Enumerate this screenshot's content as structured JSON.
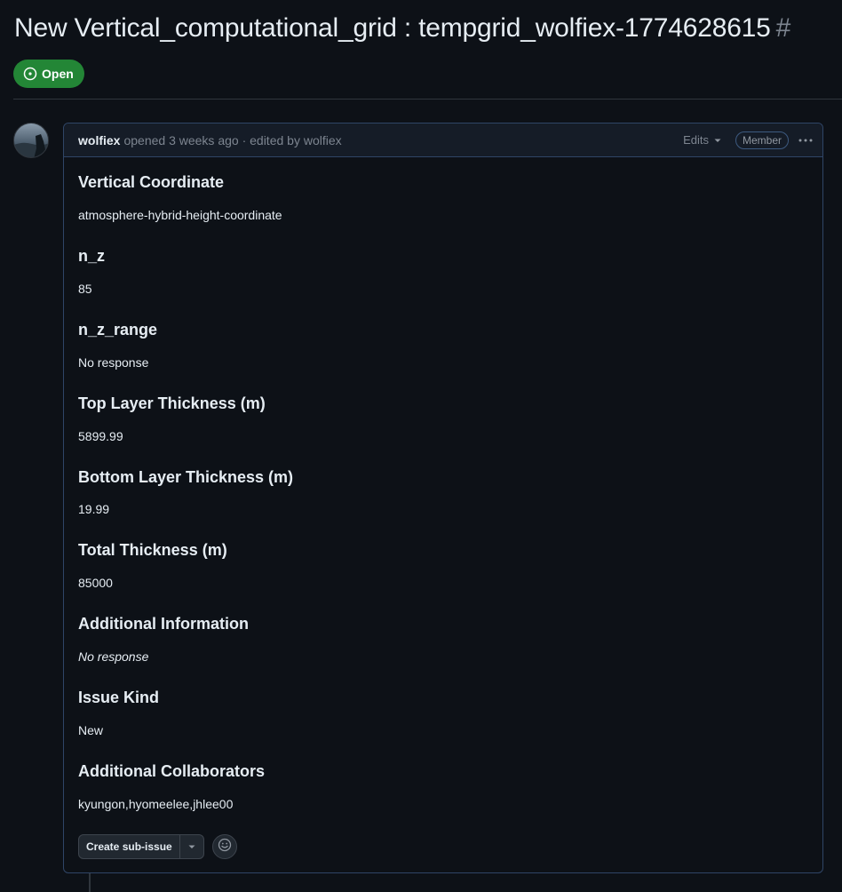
{
  "issue": {
    "title": "New Vertical_computational_grid : tempgrid_wolfiex-1774628615",
    "number_prefix": "#",
    "state": "Open",
    "state_color": "#238636"
  },
  "comment": {
    "author": "wolfiex",
    "meta": "opened 3 weeks ago · edited by wolfiex",
    "edits_label": "Edits",
    "role_badge": "Member",
    "more_icon": "kebab-horizontal-icon"
  },
  "fields": [
    {
      "heading": "Vertical Coordinate",
      "value": "atmosphere-hybrid-height-coordinate"
    },
    {
      "heading": "n_z",
      "value": "85"
    },
    {
      "heading": "n_z_range",
      "value": "No response"
    },
    {
      "heading": "Top Layer Thickness (m)",
      "value": "5899.99"
    },
    {
      "heading": "Bottom Layer Thickness (m)",
      "value": "19.99"
    },
    {
      "heading": "Total Thickness (m)",
      "value": "85000"
    },
    {
      "heading": "Additional Information",
      "value": "No response"
    },
    {
      "heading": "Issue Kind",
      "value": "New"
    },
    {
      "heading": "Additional Collaborators",
      "value": "kyungon,hyomeelee,jhlee00"
    }
  ],
  "actions": {
    "create_subissue_label": "Create sub-issue",
    "reaction_icon": "smiley-icon"
  },
  "colors": {
    "background": "#0d1117",
    "accent_border": "#2f4566",
    "header_bg": "#151c27",
    "muted_text": "#7d8590"
  }
}
